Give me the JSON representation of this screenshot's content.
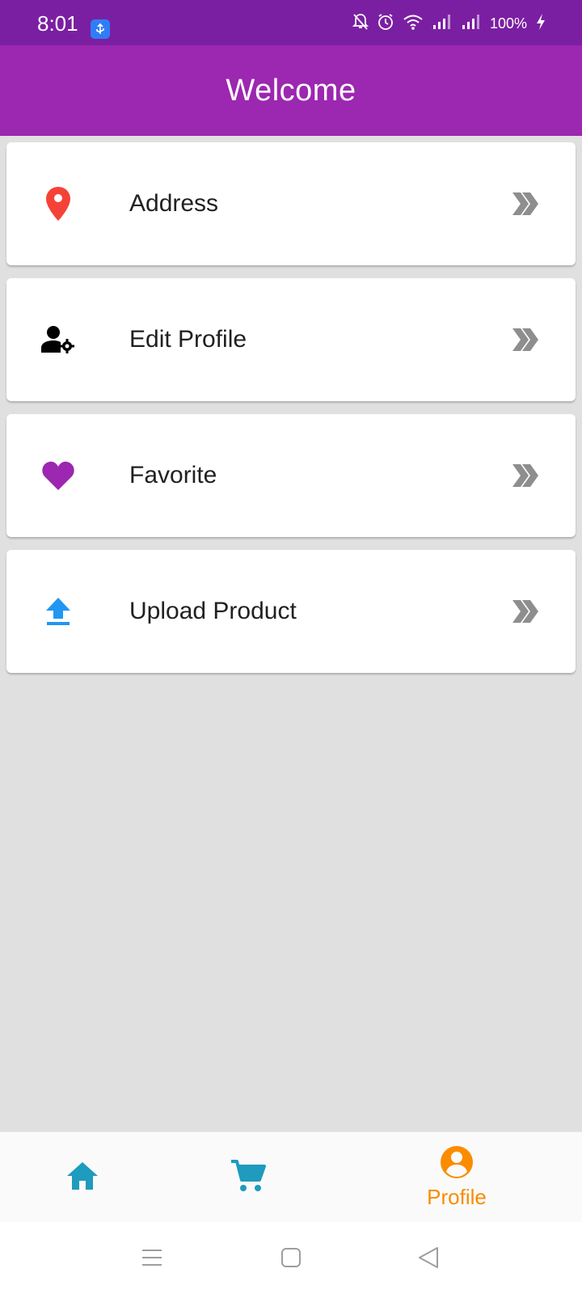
{
  "status_bar": {
    "time": "8:01",
    "battery": "100%",
    "icons": [
      "usb-icon",
      "notifications-off-icon",
      "alarm-icon",
      "wifi-icon",
      "signal-icon",
      "signal-icon",
      "charging-icon"
    ]
  },
  "app_bar": {
    "title": "Welcome",
    "color": "#9c27b0"
  },
  "menu": {
    "items": [
      {
        "label": "Address",
        "icon": "location-pin-icon",
        "icon_color": "#f44336"
      },
      {
        "label": "Edit Profile",
        "icon": "user-settings-icon",
        "icon_color": "#000000"
      },
      {
        "label": "Favorite",
        "icon": "heart-icon",
        "icon_color": "#9c27b0"
      },
      {
        "label": "Upload Product",
        "icon": "upload-icon",
        "icon_color": "#2196f3"
      }
    ],
    "chevron_icon": "double-chevron-right-icon",
    "chevron_color": "#8e8e8e"
  },
  "bottom_nav": {
    "items": [
      {
        "icon": "home-icon",
        "label": "",
        "active": false
      },
      {
        "icon": "cart-icon",
        "label": "",
        "active": false
      },
      {
        "icon": "account-circle-icon",
        "label": "Profile",
        "active": true
      }
    ],
    "inactive_color": "#1e9bbd",
    "active_color": "#fb8c00"
  },
  "system_nav": {
    "icons": [
      "menu-icon",
      "home-square-icon",
      "back-icon"
    ]
  }
}
